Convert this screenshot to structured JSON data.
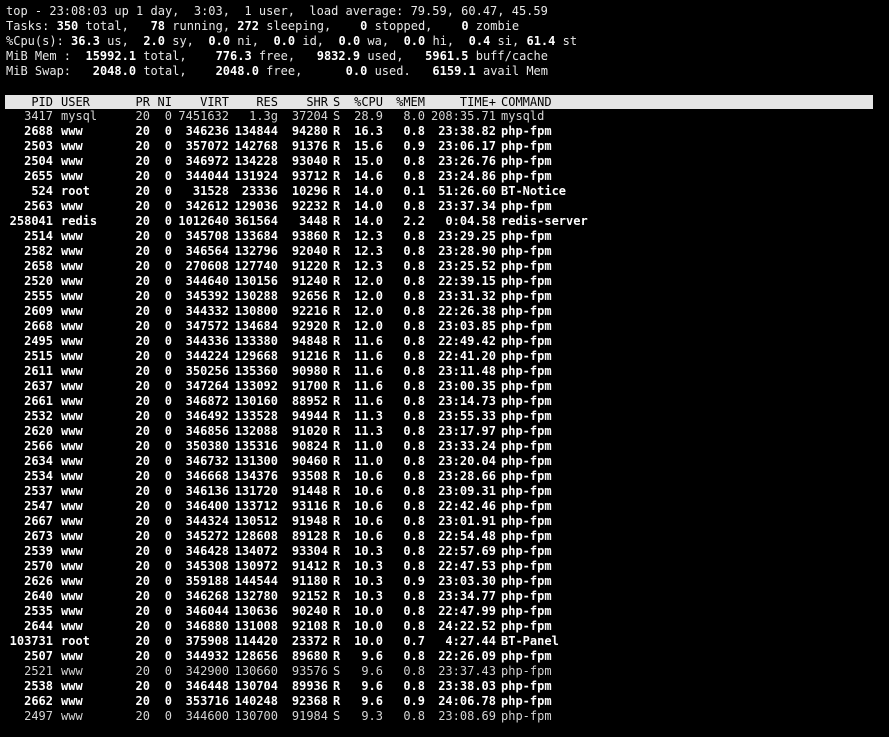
{
  "summary": {
    "uptime_line": "top - 23:08:03 up 1 day,  3:03,  1 user,  load average: 79.59, 60.47, 45.59",
    "tasks": {
      "label": "Tasks:",
      "total": "350",
      "total_label": "total,",
      "running": "78",
      "running_label": "running,",
      "sleeping": "272",
      "sleeping_label": "sleeping,",
      "stopped": "0",
      "stopped_label": "stopped,",
      "zombie": "0",
      "zombie_label": "zombie"
    },
    "cpu": {
      "label": "%Cpu(s):",
      "us": "36.3",
      "us_label": "us,",
      "sy": "2.0",
      "sy_label": "sy,",
      "ni": "0.0",
      "ni_label": "ni,",
      "id": "0.0",
      "id_label": "id,",
      "wa": "0.0",
      "wa_label": "wa,",
      "hi": "0.0",
      "hi_label": "hi,",
      "si": "0.4",
      "si_label": "si,",
      "st": "61.4",
      "st_label": "st"
    },
    "mem": {
      "label": "MiB Mem :",
      "total": "15992.1",
      "total_label": "total,",
      "free": "776.3",
      "free_label": "free,",
      "used": "9832.9",
      "used_label": "used,",
      "buff": "5961.5",
      "buff_label": "buff/cache"
    },
    "swap": {
      "label": "MiB Swap:",
      "total": "2048.0",
      "total_label": "total,",
      "free": "2048.0",
      "free_label": "free,",
      "used": "0.0",
      "used_label": "used.",
      "avail": "6159.1",
      "avail_label": "avail Mem"
    }
  },
  "columns": [
    "PID",
    "USER",
    "PR",
    "NI",
    "VIRT",
    "RES",
    "SHR",
    "S",
    "%CPU",
    "%MEM",
    "TIME+",
    "COMMAND"
  ],
  "processes": [
    [
      "3417",
      "mysql",
      "20",
      "0",
      "7451632",
      "1.3g",
      "37204",
      "S",
      "28.9",
      "8.0",
      "208:35.71",
      "mysqld"
    ],
    [
      "2688",
      "www",
      "20",
      "0",
      "346236",
      "134844",
      "94280",
      "R",
      "16.3",
      "0.8",
      "23:38.82",
      "php-fpm"
    ],
    [
      "2503",
      "www",
      "20",
      "0",
      "357072",
      "142768",
      "91376",
      "R",
      "15.6",
      "0.9",
      "23:06.17",
      "php-fpm"
    ],
    [
      "2504",
      "www",
      "20",
      "0",
      "346972",
      "134228",
      "93040",
      "R",
      "15.0",
      "0.8",
      "23:26.76",
      "php-fpm"
    ],
    [
      "2655",
      "www",
      "20",
      "0",
      "344044",
      "131924",
      "93712",
      "R",
      "14.6",
      "0.8",
      "23:24.86",
      "php-fpm"
    ],
    [
      "524",
      "root",
      "20",
      "0",
      "31528",
      "23336",
      "10296",
      "R",
      "14.0",
      "0.1",
      "51:26.60",
      "BT-Notice"
    ],
    [
      "2563",
      "www",
      "20",
      "0",
      "342612",
      "129036",
      "92232",
      "R",
      "14.0",
      "0.8",
      "23:37.34",
      "php-fpm"
    ],
    [
      "258041",
      "redis",
      "20",
      "0",
      "1012640",
      "361564",
      "3448",
      "R",
      "14.0",
      "2.2",
      "0:04.58",
      "redis-server"
    ],
    [
      "2514",
      "www",
      "20",
      "0",
      "345708",
      "133684",
      "93860",
      "R",
      "12.3",
      "0.8",
      "23:29.25",
      "php-fpm"
    ],
    [
      "2582",
      "www",
      "20",
      "0",
      "346564",
      "132796",
      "92040",
      "R",
      "12.3",
      "0.8",
      "23:28.90",
      "php-fpm"
    ],
    [
      "2658",
      "www",
      "20",
      "0",
      "270608",
      "127740",
      "91220",
      "R",
      "12.3",
      "0.8",
      "23:25.52",
      "php-fpm"
    ],
    [
      "2520",
      "www",
      "20",
      "0",
      "344640",
      "130156",
      "91240",
      "R",
      "12.0",
      "0.8",
      "22:39.15",
      "php-fpm"
    ],
    [
      "2555",
      "www",
      "20",
      "0",
      "345392",
      "130288",
      "92656",
      "R",
      "12.0",
      "0.8",
      "23:31.32",
      "php-fpm"
    ],
    [
      "2609",
      "www",
      "20",
      "0",
      "344332",
      "130800",
      "92216",
      "R",
      "12.0",
      "0.8",
      "22:26.38",
      "php-fpm"
    ],
    [
      "2668",
      "www",
      "20",
      "0",
      "347572",
      "134684",
      "92920",
      "R",
      "12.0",
      "0.8",
      "23:03.85",
      "php-fpm"
    ],
    [
      "2495",
      "www",
      "20",
      "0",
      "344336",
      "133380",
      "94848",
      "R",
      "11.6",
      "0.8",
      "22:49.42",
      "php-fpm"
    ],
    [
      "2515",
      "www",
      "20",
      "0",
      "344224",
      "129668",
      "91216",
      "R",
      "11.6",
      "0.8",
      "22:41.20",
      "php-fpm"
    ],
    [
      "2611",
      "www",
      "20",
      "0",
      "350256",
      "135360",
      "90980",
      "R",
      "11.6",
      "0.8",
      "23:11.48",
      "php-fpm"
    ],
    [
      "2637",
      "www",
      "20",
      "0",
      "347264",
      "133092",
      "91700",
      "R",
      "11.6",
      "0.8",
      "23:00.35",
      "php-fpm"
    ],
    [
      "2661",
      "www",
      "20",
      "0",
      "346872",
      "130160",
      "88952",
      "R",
      "11.6",
      "0.8",
      "23:14.73",
      "php-fpm"
    ],
    [
      "2532",
      "www",
      "20",
      "0",
      "346492",
      "133528",
      "94944",
      "R",
      "11.3",
      "0.8",
      "23:55.33",
      "php-fpm"
    ],
    [
      "2620",
      "www",
      "20",
      "0",
      "346856",
      "132088",
      "91020",
      "R",
      "11.3",
      "0.8",
      "23:17.97",
      "php-fpm"
    ],
    [
      "2566",
      "www",
      "20",
      "0",
      "350380",
      "135316",
      "90824",
      "R",
      "11.0",
      "0.8",
      "23:33.24",
      "php-fpm"
    ],
    [
      "2634",
      "www",
      "20",
      "0",
      "346732",
      "131300",
      "90460",
      "R",
      "11.0",
      "0.8",
      "23:20.04",
      "php-fpm"
    ],
    [
      "2534",
      "www",
      "20",
      "0",
      "346668",
      "134376",
      "93508",
      "R",
      "10.6",
      "0.8",
      "23:28.66",
      "php-fpm"
    ],
    [
      "2537",
      "www",
      "20",
      "0",
      "346136",
      "131720",
      "91448",
      "R",
      "10.6",
      "0.8",
      "23:09.31",
      "php-fpm"
    ],
    [
      "2547",
      "www",
      "20",
      "0",
      "346400",
      "133712",
      "93116",
      "R",
      "10.6",
      "0.8",
      "22:42.46",
      "php-fpm"
    ],
    [
      "2667",
      "www",
      "20",
      "0",
      "344324",
      "130512",
      "91948",
      "R",
      "10.6",
      "0.8",
      "23:01.91",
      "php-fpm"
    ],
    [
      "2673",
      "www",
      "20",
      "0",
      "345272",
      "128608",
      "89128",
      "R",
      "10.6",
      "0.8",
      "22:54.48",
      "php-fpm"
    ],
    [
      "2539",
      "www",
      "20",
      "0",
      "346428",
      "134072",
      "93304",
      "R",
      "10.3",
      "0.8",
      "22:57.69",
      "php-fpm"
    ],
    [
      "2570",
      "www",
      "20",
      "0",
      "345308",
      "130972",
      "91412",
      "R",
      "10.3",
      "0.8",
      "22:47.53",
      "php-fpm"
    ],
    [
      "2626",
      "www",
      "20",
      "0",
      "359188",
      "144544",
      "91180",
      "R",
      "10.3",
      "0.9",
      "23:03.30",
      "php-fpm"
    ],
    [
      "2640",
      "www",
      "20",
      "0",
      "346268",
      "132780",
      "92152",
      "R",
      "10.3",
      "0.8",
      "23:34.77",
      "php-fpm"
    ],
    [
      "2535",
      "www",
      "20",
      "0",
      "346044",
      "130636",
      "90240",
      "R",
      "10.0",
      "0.8",
      "22:47.99",
      "php-fpm"
    ],
    [
      "2644",
      "www",
      "20",
      "0",
      "346880",
      "131008",
      "92108",
      "R",
      "10.0",
      "0.8",
      "24:22.52",
      "php-fpm"
    ],
    [
      "103731",
      "root",
      "20",
      "0",
      "375908",
      "114420",
      "23372",
      "R",
      "10.0",
      "0.7",
      "4:27.44",
      "BT-Panel"
    ],
    [
      "2507",
      "www",
      "20",
      "0",
      "344932",
      "128656",
      "89680",
      "R",
      "9.6",
      "0.8",
      "22:26.09",
      "php-fpm"
    ],
    [
      "2521",
      "www",
      "20",
      "0",
      "342900",
      "130660",
      "93576",
      "S",
      "9.6",
      "0.8",
      "23:37.43",
      "php-fpm"
    ],
    [
      "2538",
      "www",
      "20",
      "0",
      "346448",
      "130704",
      "89936",
      "R",
      "9.6",
      "0.8",
      "23:38.03",
      "php-fpm"
    ],
    [
      "2662",
      "www",
      "20",
      "0",
      "353716",
      "140248",
      "92368",
      "R",
      "9.6",
      "0.9",
      "24:06.78",
      "php-fpm"
    ],
    [
      "2497",
      "www",
      "20",
      "0",
      "344600",
      "130700",
      "91984",
      "S",
      "9.3",
      "0.8",
      "23:08.69",
      "php-fpm"
    ]
  ]
}
